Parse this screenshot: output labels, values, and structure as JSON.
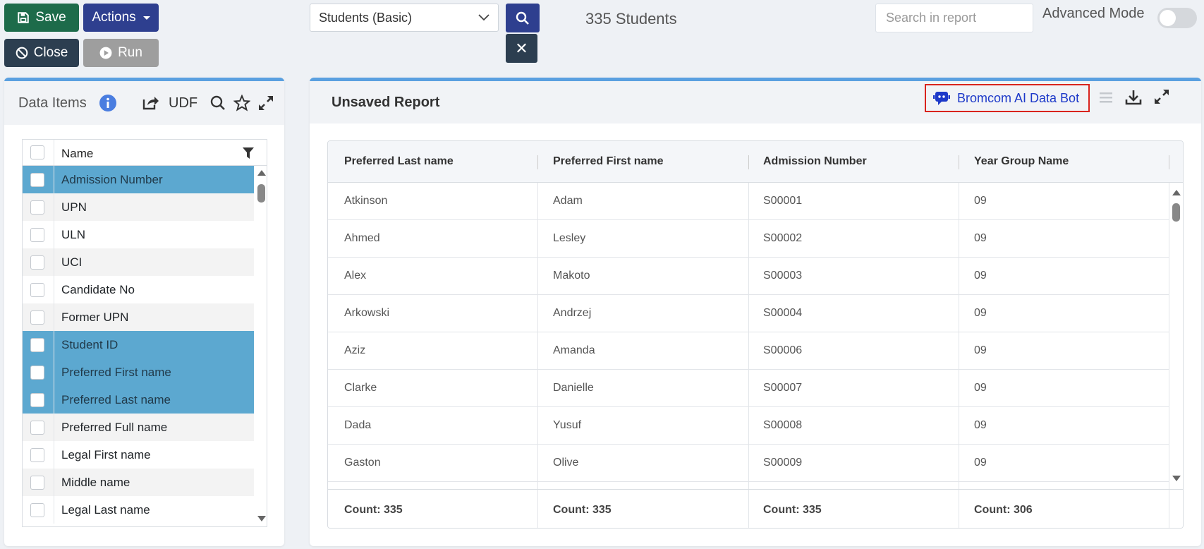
{
  "toolbar": {
    "save_label": "Save",
    "actions_label": "Actions",
    "close_label": "Close",
    "run_label": "Run"
  },
  "report_select": {
    "value": "Students (Basic)"
  },
  "student_count": "335 Students",
  "search": {
    "placeholder": "Search in report"
  },
  "advanced_mode": {
    "label": "Advanced Mode",
    "enabled": false
  },
  "data_items": {
    "title": "Data Items",
    "udf_label": "UDF",
    "column_header": "Name",
    "items": [
      {
        "label": "Admission Number",
        "selected": true
      },
      {
        "label": "UPN",
        "selected": false
      },
      {
        "label": "ULN",
        "selected": false
      },
      {
        "label": "UCI",
        "selected": false
      },
      {
        "label": "Candidate No",
        "selected": false
      },
      {
        "label": "Former UPN",
        "selected": false
      },
      {
        "label": "Student ID",
        "selected": true
      },
      {
        "label": "Preferred First name",
        "selected": true
      },
      {
        "label": "Preferred Last name",
        "selected": true
      },
      {
        "label": "Preferred Full name",
        "selected": false
      },
      {
        "label": "Legal First name",
        "selected": false
      },
      {
        "label": "Middle name",
        "selected": false
      },
      {
        "label": "Legal Last name",
        "selected": false
      }
    ]
  },
  "report": {
    "title": "Unsaved Report",
    "ai_bot_label": "Bromcom AI Data Bot",
    "columns": [
      "Preferred Last name",
      "Preferred First name",
      "Admission Number",
      "Year Group Name"
    ],
    "rows": [
      [
        "Atkinson",
        "Adam",
        "S00001",
        "09"
      ],
      [
        "Ahmed",
        "Lesley",
        "S00002",
        "09"
      ],
      [
        "Alex",
        "Makoto",
        "S00003",
        "09"
      ],
      [
        "Arkowski",
        "Andrzej",
        "S00004",
        "09"
      ],
      [
        "Aziz",
        "Amanda",
        "S00006",
        "09"
      ],
      [
        "Clarke",
        "Danielle",
        "S00007",
        "09"
      ],
      [
        "Dada",
        "Yusuf",
        "S00008",
        "09"
      ],
      [
        "Gaston",
        "Olive",
        "S00009",
        "09"
      ]
    ],
    "footer": [
      "Count: 335",
      "Count: 335",
      "Count: 335",
      "Count: 306"
    ]
  },
  "colors": {
    "save": "#1d6b4a",
    "primary": "#2e3f8f",
    "dark": "#2c3e50",
    "disabled": "#9e9e9e",
    "selected_row": "#5ca8d0",
    "panel_accent": "#5aa0e0",
    "highlight_border": "#d9231d"
  }
}
